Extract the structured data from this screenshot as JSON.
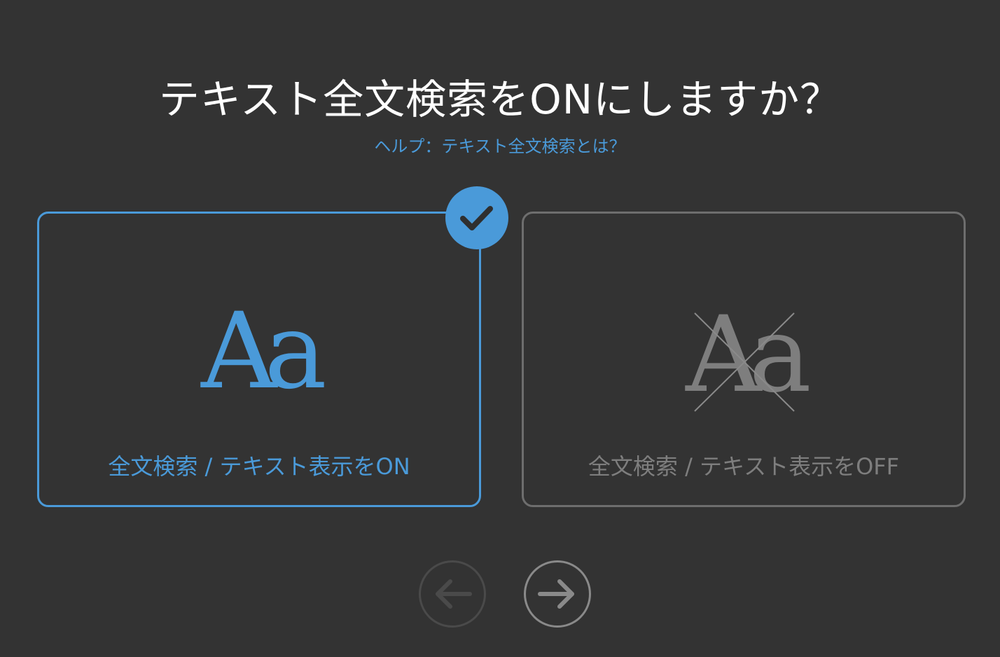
{
  "dialog": {
    "title": "テキスト全文検索をONにしますか？",
    "help_link": "ヘルプ：テキスト全文検索とは？"
  },
  "options": [
    {
      "id": "on",
      "glyph_text": "Aa",
      "label": "全文検索 / テキスト表示をON",
      "selected": true,
      "color": "#4a9ad9",
      "icon": "text-aa-icon"
    },
    {
      "id": "off",
      "glyph_text": "Aa",
      "label": "全文検索 / テキスト表示をOFF",
      "selected": false,
      "color": "#7e7e7e",
      "icon": "text-aa-crossed-icon"
    }
  ],
  "selected_badge": {
    "icon": "check-icon",
    "color": "#4a9ad9"
  },
  "navigation": {
    "prev": {
      "icon": "arrow-left-icon",
      "enabled": false
    },
    "next": {
      "icon": "arrow-right-icon",
      "enabled": true
    }
  },
  "colors": {
    "background": "#333333",
    "accent": "#4a9ad9",
    "muted": "#6e6e6e",
    "title": "#ffffff"
  }
}
